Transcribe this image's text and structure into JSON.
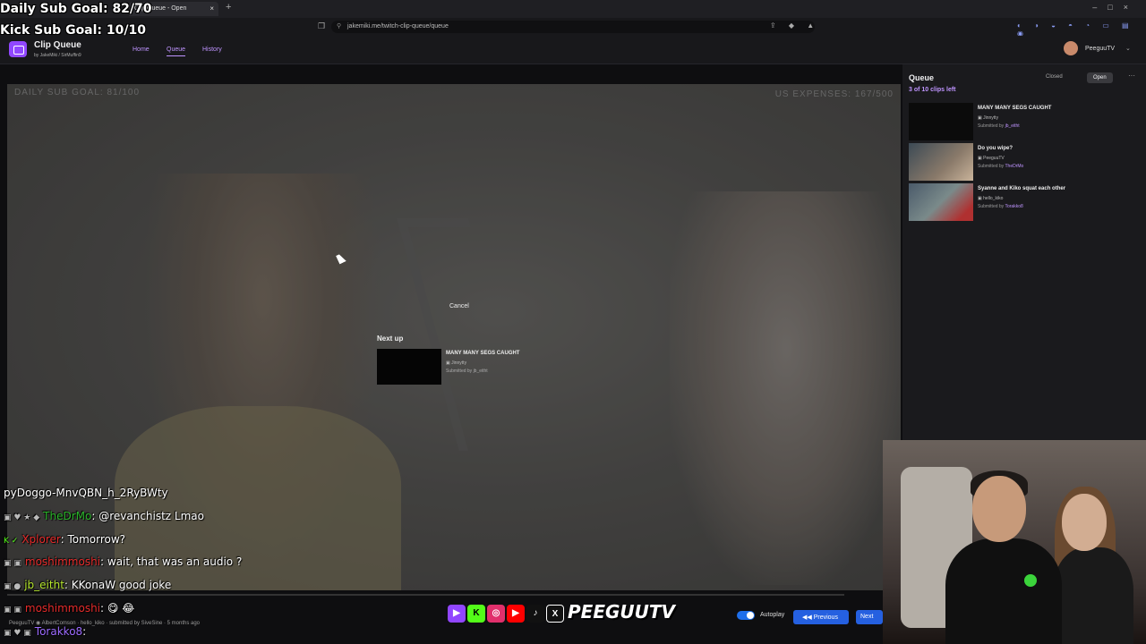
{
  "browser": {
    "tab_title": "Clip Queue - Open",
    "tab_close": "×",
    "new_tab": "+",
    "window_controls": "–□×",
    "url": "jakemiki.me/twitch-clip-queue/queue"
  },
  "stream_overlay": {
    "daily_sub_goal": "Daily Sub Goal: 82/70",
    "kick_sub_goal": "Kick Sub Goal: 10/10"
  },
  "app": {
    "title": "Clip Queue",
    "byline": "by JakeMiki / SirMuffin9",
    "nav": {
      "home": "Home",
      "queue": "Queue",
      "history": "History"
    },
    "user": {
      "name": "PeeguuTV"
    }
  },
  "player": {
    "overlay_left": "DAILY SUB GOAL: 81/100",
    "overlay_right": "US EXPENSES: 167/500",
    "cancel": "Cancel",
    "next_up": {
      "label": "Next up",
      "title": "MANY MANY SEGS CAUGHT",
      "channel": "Jinnytty",
      "submitted_by": "Submitted by jb_eitht"
    }
  },
  "queue": {
    "title": "Queue",
    "count": "3 of 10 clips left",
    "closed": "Closed",
    "open": "Open",
    "more": "···",
    "items": [
      {
        "title": "MANY MANY SEGS CAUGHT",
        "channel": "Jinnytty",
        "submitted_prefix": "Submitted by ",
        "submitter": "jb_eitht"
      },
      {
        "title": "Do you wipe?",
        "channel": "PeeguuTV",
        "submitted_prefix": "Submitted by ",
        "submitter": "TheDrMo"
      },
      {
        "title": "Syanne and Kiko squat each other",
        "channel": "hello_kiko",
        "submitted_prefix": "Submitted by ",
        "submitter": "Torakko8"
      }
    ]
  },
  "chat": [
    {
      "badges": "",
      "user": "",
      "color": "#ffffff",
      "message": "pyDoggo-MnvQBN_h_2RyBWty"
    },
    {
      "badges": "▣ ♥ ★ ◆",
      "user": "TheDrMo",
      "color": "#2bb52b",
      "message": ": @revanchistz Lmao"
    },
    {
      "badges": "K ✓",
      "user": "Xplorer",
      "color": "#e52b2b",
      "message": ": Tomorrow?"
    },
    {
      "badges": "▣ ▣",
      "user": "moshimmoshi",
      "color": "#e52b2b",
      "message": ": wait, that was an audio ?"
    },
    {
      "badges": "▣ ●",
      "user": "jb_eitht",
      "color": "#b7e82e",
      "message": ": KKonaW good joke"
    },
    {
      "badges": "▣ ▣",
      "user": "moshimmoshi",
      "color": "#e52b2b",
      "message": ": 😋 😂"
    },
    {
      "badges": "▣ ♥ ▣",
      "user": "Torakko8",
      "color": "#9d6bff",
      "message": ":"
    }
  ],
  "chat_extra": {
    "clip_credit": "hello_kiko · submitted by SiveSine · 5 months ago",
    "clip_line": "PeeguuTV ◉ AlbertComson"
  },
  "social": {
    "twitch": "▶",
    "kick": "K",
    "instagram": "◎",
    "youtube": "▶",
    "tiktok": "♪",
    "x": "X",
    "handle": "PEEGUUTV"
  },
  "controls": {
    "autoplay": "Autoplay",
    "previous": "◀◀ Previous",
    "next": "Next"
  }
}
